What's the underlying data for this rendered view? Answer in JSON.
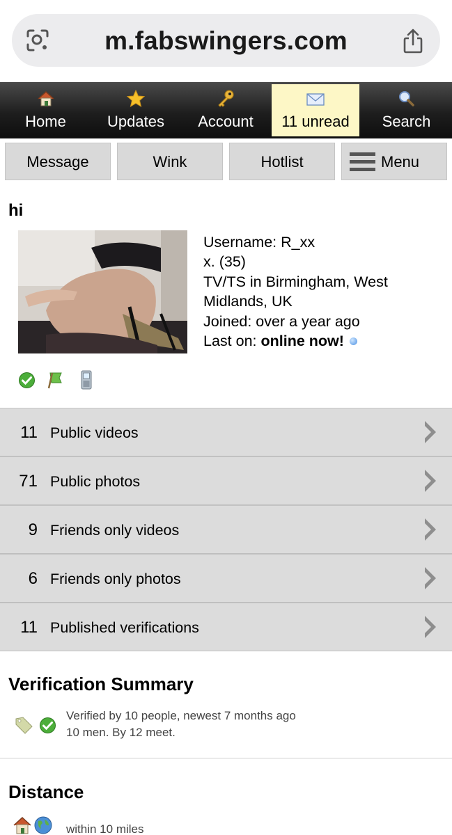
{
  "browser": {
    "url": "m.fabswingers.com",
    "icons": [
      "lens-icon",
      "share-icon"
    ]
  },
  "nav": {
    "items": [
      {
        "label": "Home",
        "icon": "home-icon"
      },
      {
        "label": "Updates",
        "icon": "star-icon"
      },
      {
        "label": "Account",
        "icon": "key-icon"
      },
      {
        "label": "11 unread",
        "icon": "envelope-icon",
        "active": true
      },
      {
        "label": "Search",
        "icon": "magnifier-icon"
      }
    ]
  },
  "actions": {
    "message": "Message",
    "wink": "Wink",
    "hotlist": "Hotlist",
    "menu": "Menu"
  },
  "profile": {
    "title": "hi",
    "username_label": "Username:",
    "username": "R_xx",
    "age_line": "x. (35)",
    "location_line1": "TV/TS in Birmingham, West",
    "location_line2": "Midlands, UK",
    "joined": "Joined: over a year ago",
    "last_on_label": "Last on:",
    "last_on_value": "online now!",
    "badges": [
      "verified-check-icon",
      "flag-icon",
      "mobile-phone-icon"
    ]
  },
  "media": [
    {
      "count": "11",
      "label": "Public videos"
    },
    {
      "count": "71",
      "label": "Public photos"
    },
    {
      "count": "9",
      "label": "Friends only videos"
    },
    {
      "count": "6",
      "label": "Friends only photos"
    },
    {
      "count": "11",
      "label": "Published verifications"
    }
  ],
  "verification": {
    "title": "Verification Summary",
    "line1": "Verified by 10 people, newest 7 months ago",
    "line2": "10 men. By 12 meet."
  },
  "distance": {
    "title": "Distance",
    "text": "within 10 miles"
  },
  "colors": {
    "nav_bg": "#1e1e1e",
    "nav_active_bg": "#fdf7c6",
    "button_bg": "#d9d9d9",
    "row_bg": "#dcdcdc",
    "online_dot": "#4a90e2"
  }
}
